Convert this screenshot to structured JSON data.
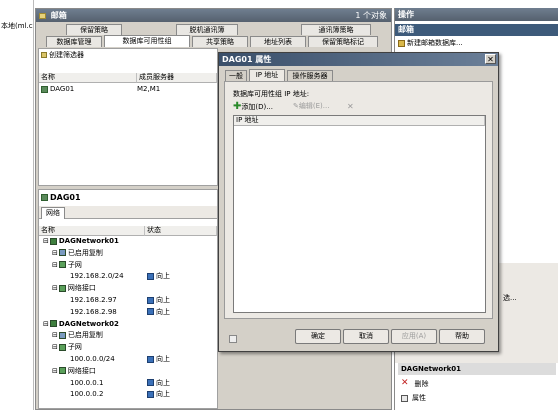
{
  "left_edge_text": "本地(ml.c",
  "mmc": {
    "title": "邮箱",
    "count": "1 个对象",
    "tabs_row1": [
      "保留策略",
      "脱机通讯簿",
      "通讯簿策略"
    ],
    "tabs_row2": [
      "数据库管理",
      "数据库可用性组",
      "共享策略",
      "地址列表",
      "保留策略标记"
    ],
    "filter": "创建筛选器",
    "columns": [
      "名称",
      "成员服务器"
    ],
    "dag_row": {
      "name": "DAG01",
      "members": "M2,M1"
    },
    "detail_title": "DAG01",
    "detail_tab": "网络",
    "detail_columns": [
      "名称",
      "状态"
    ],
    "tree": [
      {
        "text": "DAGNetwork01",
        "icon": "network-icon",
        "status": "",
        "indent": 0
      },
      {
        "text": "已启用复制",
        "icon": "replication-icon",
        "status": "",
        "indent": 1
      },
      {
        "text": "子网",
        "icon": "subnet-icon",
        "status": "",
        "indent": 1
      },
      {
        "text": "192.168.2.0/24",
        "icon": "",
        "status": "向上",
        "indent": 3
      },
      {
        "text": "网络接口",
        "icon": "interface-icon",
        "status": "",
        "indent": 1
      },
      {
        "text": "192.168.2.97",
        "icon": "",
        "status": "向上",
        "indent": 3
      },
      {
        "text": "192.168.2.98",
        "icon": "",
        "status": "向上",
        "indent": 3
      },
      {
        "text": "DAGNetwork02",
        "icon": "network-icon",
        "status": "",
        "indent": 0
      },
      {
        "text": "已启用复制",
        "icon": "replication-icon",
        "status": "",
        "indent": 1
      },
      {
        "text": "子网",
        "icon": "subnet-icon",
        "status": "",
        "indent": 1
      },
      {
        "text": "100.0.0.0/24",
        "icon": "",
        "status": "向上",
        "indent": 3
      },
      {
        "text": "网络接口",
        "icon": "interface-icon",
        "status": "",
        "indent": 1
      },
      {
        "text": "100.0.0.1",
        "icon": "",
        "status": "向上",
        "indent": 3
      },
      {
        "text": "100.0.0.2",
        "icon": "",
        "status": "向上",
        "indent": 3
      }
    ]
  },
  "actions": {
    "title": "操作",
    "section1": "邮箱",
    "new_db": "新建邮箱数据库...",
    "mid_item": "选...",
    "section2": "DAGNetwork01",
    "delete": "删除",
    "properties": "属性"
  },
  "dialog": {
    "title": "DAG01 属性",
    "tabs": [
      "一般",
      "IP 地址",
      "操作服务器"
    ],
    "label": "数据库可用性组 IP 地址:",
    "add": "添加(D)...",
    "edit": "编辑(E)...",
    "list_header": "IP 地址",
    "ok": "确定",
    "cancel": "取消",
    "apply": "应用(A)",
    "help": "帮助"
  }
}
